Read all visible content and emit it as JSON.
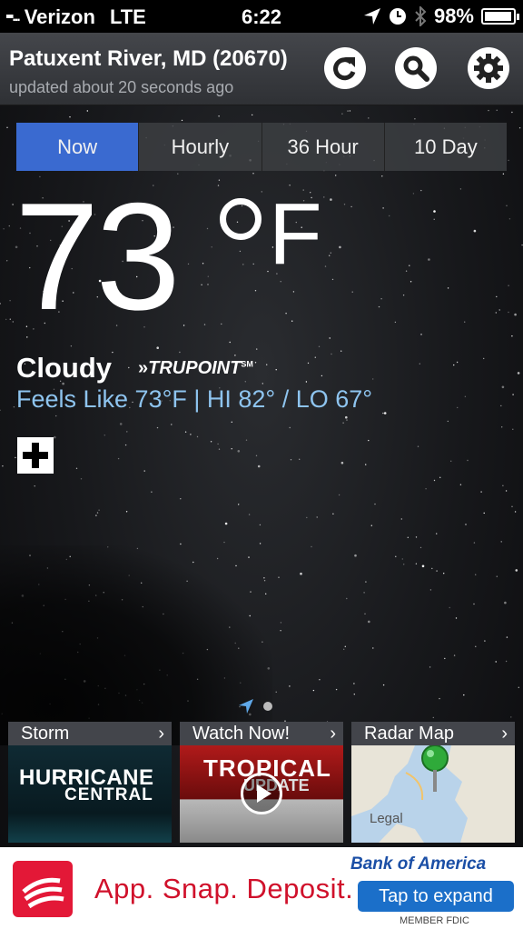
{
  "status_bar": {
    "signal": "▪▪...",
    "carrier": "Verizon",
    "network": "LTE",
    "time": "6:22",
    "battery": "98%",
    "battery_level": 0.98
  },
  "header": {
    "location": "Patuxent River, MD (20670)",
    "updated": "updated about 20 seconds ago"
  },
  "tabs": [
    {
      "label": "Now",
      "active": true
    },
    {
      "label": "Hourly",
      "active": false
    },
    {
      "label": "36 Hour",
      "active": false
    },
    {
      "label": "10 Day",
      "active": false
    }
  ],
  "current": {
    "temperature": "73",
    "unit": "F",
    "condition": "Cloudy",
    "brand": "TRUPOINT",
    "brand_mark": "SM",
    "feels_like": "Feels Like 73°F | HI 82° / LO 67°"
  },
  "cards": [
    {
      "title": "Storm",
      "img_title": "HURRICANE",
      "img_sub": "CENTRAL"
    },
    {
      "title": "Watch Now!",
      "img_title": "TROPICAL",
      "img_sub": "UPDATE"
    },
    {
      "title": "Radar Map",
      "img_legal": "Legal"
    }
  ],
  "ad": {
    "tagline": "App. Snap. Deposit.",
    "brand": "Bank of America",
    "button": "Tap to expand",
    "footer": "MEMBER FDIC"
  },
  "colors": {
    "accent": "#3a6ad0",
    "feels_like": "#8ec4ef",
    "ad_red": "#d0112b"
  }
}
